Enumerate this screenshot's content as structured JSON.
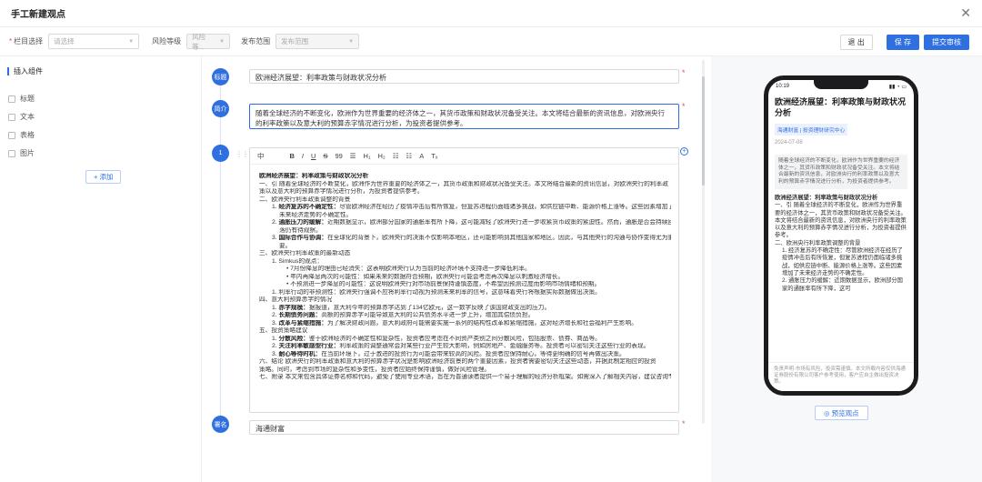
{
  "dialog": {
    "title": "手工新建观点"
  },
  "topbar": {
    "column_label": "栏目选择",
    "column_placeholder": "请选择",
    "risk_label": "风险等级",
    "risk_value": "风险等...",
    "publish_label": "发布范围",
    "publish_value": "发布范围",
    "exit": "退 出",
    "save": "保 存",
    "submit": "提交审核"
  },
  "left": {
    "header": "插入组件",
    "items": [
      "标题",
      "文本",
      "表格",
      "图片"
    ],
    "add": "+ 添加"
  },
  "nodes": {
    "title": "标题",
    "summary": "简介",
    "step": "1",
    "keys": "署名"
  },
  "fields": {
    "title": "欧洲经济展望：利率政策与财政状况分析",
    "summary_line1": "随着全球经济的不断变化，欧洲作为世界重要的经济体之一，其货币政策和财政状况备受关注。本文将结合最新的资讯信息，对欧洲央行",
    "summary_line2": "的利率政策以及意大利的预算赤字情况进行分析，为投资者提供参考。",
    "bottom": "海通财富"
  },
  "toolbar": [
    "中",
    "B",
    "I",
    "U",
    "S",
    "99",
    "☰",
    "H₁",
    "H₂",
    "☷",
    "☷",
    "A",
    "Tₓ"
  ],
  "editor": {
    "lines": [
      {
        "t": "欧洲经济展望：利率政策与财政状况分析",
        "h": true
      },
      {
        "t": "一、引 随着全球经济的不断变化，欧洲作为世界重要的经济体之一，其货币政策和财政状况备受关注。本文将结合最新的资讯信息，对欧洲央行的利率政"
      },
      {
        "t": "策以及意大利的预算赤字情况进行分析，为投资者提供参考。"
      },
      {
        "t": "二、欧洲央行利率政策调整的背景"
      },
      {
        "t": "1. 经济复苏的不确定性：尽管欧洲经济在经历了疫情冲击后有所恢复，但复苏进程仍面临诸多挑战，如供应链中断、能源价格上涨等。这些因素增加了",
        "i": 1,
        "b": "经济复苏的不确定性："
      },
      {
        "t": "未来经济走势的不确定性。",
        "i": 2
      },
      {
        "t": "2. 通胀压力的缓解：近期数据显示，欧洲部分国家的通胀率有所下降，这可能减轻了欧洲央行进一步收紧货币政策的紧迫性。然而，通胀是否会持续回",
        "i": 1,
        "b": "通胀压力的缓解："
      },
      {
        "t": "落仍有待观察。",
        "i": 2
      },
      {
        "t": "3. 国际合作与协调：在全球化的背景下，欧洲央行的决策不仅影响本地区，还可能影响到其他国家和地区。因此，与其他央行的沟通与协作变得尤为重",
        "i": 1,
        "b": "国际合作与协调："
      },
      {
        "t": "要。",
        "i": 2
      },
      {
        "t": "三、欧洲央行利率政策的最新动态"
      },
      {
        "t": "1. Simkus的观点：",
        "i": 1
      },
      {
        "t": "• 7月份降息的理由已经消失：这表明欧洲央行认为当前的经济环境不支持进一步降低利率。",
        "i": 3
      },
      {
        "t": "• 年内再降息两次的可能性：如果未来的数据符合预期，欧洲央行可能会考虑再次降息以刺激经济增长。",
        "i": 3
      },
      {
        "t": "• 不预测进一步降息的可能性：这说明欧洲央行对市场前景保持谨慎态度，不希望因预测过度而影响市场情绪和预期。",
        "i": 3
      },
      {
        "t": "1. 利率行动的非预测性：欧洲央行强调不应将利率行动视为预测未来利率的信号，这意味着央行将根据实际数据做出决策。",
        "i": 1
      },
      {
        "t": "四、意大利预算赤字的情况"
      },
      {
        "t": "1. 赤字规模：据报道，意大利今年的预算赤字达到了134亿欧元，这一数字反映了该国财政支出的压力。",
        "i": 1,
        "b": "赤字规模："
      },
      {
        "t": "2. 长期债务问题：高额的预算赤字可能导致意大利的公共债务水平进一步上升，增加其偿债负担。",
        "i": 1,
        "b": "长期债务问题："
      },
      {
        "t": "3. 改革与紧缩措施：为了解决财政问题，意大利政府可能需要实施一系列的结构性改革和紧缩措施，这对经济增长和社会福利产生影响。",
        "i": 1,
        "b": "改革与紧缩措施："
      },
      {
        "t": "五、投资策略建议"
      },
      {
        "t": "1. 分散风险：鉴于欧洲经济的不确定性和复杂性，投资者应考虑在不同资产类别之间分散风险，包括股票、债券、商品等。",
        "i": 1,
        "b": "分散风险："
      },
      {
        "t": "2. 关注利率敏感型行业：利率政策的调整通常会对某些行业产生较大影响，例如房地产、金融服务等。投资者可以密切关注这些行业的表现。",
        "i": 1,
        "b": "关注利率敏感型行业："
      },
      {
        "t": "3. 耐心等待时机：在当前环境下，过于激进的投资行为可能会带来较高的风险。投资者应保持耐心，等待更明确的信号再做出决策。",
        "i": 1,
        "b": "耐心等待时机："
      },
      {
        "t": "六、结论 欧洲央行的利率政策和意大利的预算赤字状况是影响欧洲经济前景的两个重要因素，投资者需要密切关注这些动态，并据此制定相应的投资"
      },
      {
        "t": "策略。同时，考虑到市场的复杂性和多变性，投资者应始终保持谨慎，做好风险管理。"
      },
      {
        "t": "七、附录 本文来包含具体证券名称和代码，避免了使用专业术语，旨在为普通读者提供一个易于理解的经济分析框架。如需深入了解相关内容，建议咨询专"
      }
    ]
  },
  "phone": {
    "time": "10:19",
    "signal": "▮▮ ◔ ▭",
    "title": "欧洲经济展望：利率政策与财政状况分析",
    "tag": "海通财富 | 投资理财研究中心",
    "date": "2024-07-08",
    "summary": "随着全球经济的不断变化，欧洲作为世界重要的经济体之一，其货币政策和财政状况备受关注。本文将结合最新的资讯信息，对欧洲央行的利率政策以及意大利的预算赤字情况进行分析，为投资者提供参考。",
    "body_title": "欧洲经济展望：利率政策与财政状况分析",
    "body_lines": [
      "一、引 随着全球经济的不断变化，欧洲作为世界重要的经济体之一，其货币政策和财政状况备受关注。本文将结合最新的资讯信息，对欧洲央行的利率政策以及意大利的预算赤字情况进行分析，为投资者提供参考。",
      "二、欧洲央行利率政策调整的背景"
    ],
    "ind_lines": [
      "1. 经济复苏的不确定性：尽管欧洲经济在经历了疫情冲击后有所恢复，但复苏进程仍面临诸多挑战，如供应链中断、能源价格上涨等。这些因素增加了未来经济走势的不确定性。",
      "2. 通胀压力的缓解：近期数据显示，欧洲部分国家的通胀率有所下降，这可"
    ],
    "footer": "免责声明·市场有风险，投资需谨慎。本文所载内容仅供海通证券股份有限公司客户参考使用，客户应自主做出投资决策。"
  },
  "preview": "◎ 预览观点"
}
